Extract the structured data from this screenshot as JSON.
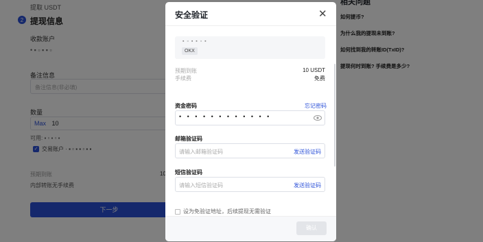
{
  "background": {
    "breadcrumb": "提取 USDT",
    "step_number": "2",
    "step_title": "提现信息",
    "receive_label": "收款账户",
    "receive_value": "• ▪ ▫ ▪ ▪ ▫",
    "memo_label": "备注信息",
    "memo_placeholder": "备注信息(非必填)",
    "amount_label": "数量",
    "amount_max": "Max",
    "amount_value": "10",
    "available_label": "可用: ▪ ▫ ▪ ▫ ▪",
    "trading_account_label": "交易账户 · ▪ ▫ ▪ ▪ ▫ ▪ ▪",
    "estimated_label": "预期到账",
    "estimated_value": "10",
    "internal_note": "内部转账无手续费",
    "next_button": "下一步",
    "faq_title": "相关问题",
    "faq_items": [
      "如何提币?",
      "为什么我的提现未到账?",
      "如何找到我的转账ID(TxID)?",
      "提现何时到账? 手续费是多少?"
    ]
  },
  "modal": {
    "title": "安全验证",
    "address": "▪ ▫ ▪ ▪ ▫ ▪",
    "address_tag": "OKX",
    "expected_label": "预期到账",
    "expected_value": "10 USDT",
    "fee_label": "手续费",
    "fee_value": "免费",
    "fund_password_label": "资金密码",
    "forgot_password_link": "忘记密码",
    "fund_password_value": "• • • • • • • • • • • •",
    "email_code_label": "邮箱验证码",
    "email_code_placeholder": "请输入邮箱验证码",
    "send_code_email": "发送验证码",
    "sms_code_label": "短信验证码",
    "sms_code_placeholder": "请输入短信验证码",
    "send_code_sms": "发送验证码",
    "whitelist_text": "设为免验证地址，后续提现无需验证",
    "confirm_button": "确认"
  }
}
